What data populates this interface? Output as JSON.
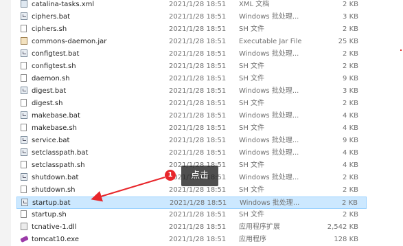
{
  "files": [
    {
      "name": "catalina-tasks.xml",
      "date": "2021/1/28 18:51",
      "type": "XML 文档",
      "size": "2 KB",
      "icon": "xml-file-icon"
    },
    {
      "name": "ciphers.bat",
      "date": "2021/1/28 18:51",
      "type": "Windows 批处理...",
      "size": "3 KB",
      "icon": "batch-file-icon"
    },
    {
      "name": "ciphers.sh",
      "date": "2021/1/28 18:51",
      "type": "SH 文件",
      "size": "2 KB",
      "icon": "sh-file-icon"
    },
    {
      "name": "commons-daemon.jar",
      "date": "2021/1/28 18:51",
      "type": "Executable Jar File",
      "size": "25 KB",
      "icon": "jar-file-icon"
    },
    {
      "name": "configtest.bat",
      "date": "2021/1/28 18:51",
      "type": "Windows 批处理...",
      "size": "2 KB",
      "icon": "batch-file-icon"
    },
    {
      "name": "configtest.sh",
      "date": "2021/1/28 18:51",
      "type": "SH 文件",
      "size": "2 KB",
      "icon": "sh-file-icon"
    },
    {
      "name": "daemon.sh",
      "date": "2021/1/28 18:51",
      "type": "SH 文件",
      "size": "9 KB",
      "icon": "sh-file-icon"
    },
    {
      "name": "digest.bat",
      "date": "2021/1/28 18:51",
      "type": "Windows 批处理...",
      "size": "3 KB",
      "icon": "batch-file-icon"
    },
    {
      "name": "digest.sh",
      "date": "2021/1/28 18:51",
      "type": "SH 文件",
      "size": "2 KB",
      "icon": "sh-file-icon"
    },
    {
      "name": "makebase.bat",
      "date": "2021/1/28 18:51",
      "type": "Windows 批处理...",
      "size": "4 KB",
      "icon": "batch-file-icon"
    },
    {
      "name": "makebase.sh",
      "date": "2021/1/28 18:51",
      "type": "SH 文件",
      "size": "4 KB",
      "icon": "sh-file-icon"
    },
    {
      "name": "service.bat",
      "date": "2021/1/28 18:51",
      "type": "Windows 批处理...",
      "size": "9 KB",
      "icon": "batch-file-icon"
    },
    {
      "name": "setclasspath.bat",
      "date": "2021/1/28 18:51",
      "type": "Windows 批处理...",
      "size": "4 KB",
      "icon": "batch-file-icon"
    },
    {
      "name": "setclasspath.sh",
      "date": "2021/1/28 18:51",
      "type": "SH 文件",
      "size": "4 KB",
      "icon": "sh-file-icon"
    },
    {
      "name": "shutdown.bat",
      "date": "2021/1/28 18:51",
      "type": "Windows 批处理...",
      "size": "2 KB",
      "icon": "batch-file-icon"
    },
    {
      "name": "shutdown.sh",
      "date": "2021/1/28 18:51",
      "type": "SH 文件",
      "size": "2 KB",
      "icon": "sh-file-icon"
    },
    {
      "name": "startup.bat",
      "date": "2021/1/28 18:51",
      "type": "Windows 批处理...",
      "size": "2 KB",
      "icon": "batch-file-icon",
      "selected": true
    },
    {
      "name": "startup.sh",
      "date": "2021/1/28 18:51",
      "type": "SH 文件",
      "size": "2 KB",
      "icon": "sh-file-icon"
    },
    {
      "name": "tcnative-1.dll",
      "date": "2021/1/28 18:51",
      "type": "应用程序扩展",
      "size": "2,542 KB",
      "icon": "dll-file-icon"
    },
    {
      "name": "tomcat10.exe",
      "date": "2021/1/28 18:51",
      "type": "应用程序",
      "size": "128 KB",
      "icon": "exe-file-icon"
    }
  ],
  "annotation": {
    "step_number": "1",
    "tooltip_text": "点击",
    "badge_color": "#e8262b",
    "arrow_color": "#e8262b"
  },
  "colors": {
    "selection_background": "#cce8ff",
    "selection_border": "#99d1ff"
  }
}
